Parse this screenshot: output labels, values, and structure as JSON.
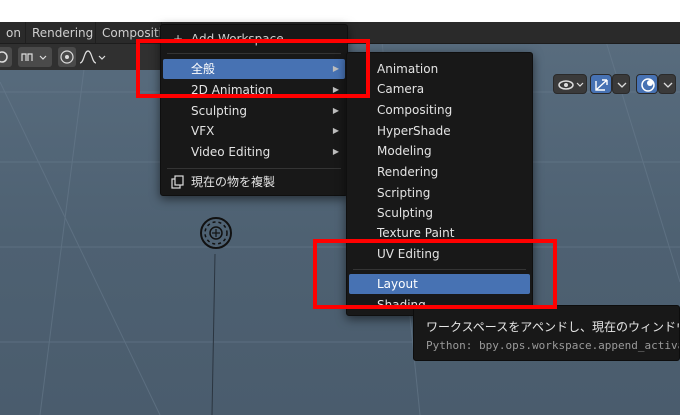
{
  "topbar": {
    "tabs": [
      {
        "label": "on"
      },
      {
        "label": "Rendering"
      },
      {
        "label": "Compositi"
      }
    ]
  },
  "header": {
    "select_mode_icon": "object-select-icon",
    "snap_icon": "snap-icon",
    "proportional_icon": "proportional-edit-icon",
    "falloff_icon": "falloff-curve-icon"
  },
  "viewport_tools": {
    "visibility_icon": "eye-icon",
    "gizmo_icon": "gizmo-icon",
    "overlay_icon": "overlay-icon"
  },
  "add_menu": {
    "header_label": "Add Workspace",
    "items": [
      {
        "label": "全般",
        "highlighted": true
      },
      {
        "label": "2D Animation"
      },
      {
        "label": "Sculpting"
      },
      {
        "label": "VFX"
      },
      {
        "label": "Video Editing"
      }
    ],
    "duplicate_label": "現在の物を複製",
    "duplicate_icon": "duplicate-icon"
  },
  "sub_menu": {
    "items": [
      {
        "label": "Animation"
      },
      {
        "label": "Camera"
      },
      {
        "label": "Compositing"
      },
      {
        "label": "HyperShade"
      },
      {
        "label": "Modeling"
      },
      {
        "label": "Rendering"
      },
      {
        "label": "Scripting"
      },
      {
        "label": "Sculpting"
      },
      {
        "label": "Texture Paint"
      },
      {
        "label": "UV Editing"
      },
      {
        "label": "Layout",
        "highlighted": true
      },
      {
        "label": "Shading"
      }
    ]
  },
  "tooltip": {
    "description": "ワークスペースをアペンドし、現在のウィンドウで",
    "python": "Python: bpy.ops.workspace.append_activate"
  },
  "colors": {
    "highlight": "#4772b3",
    "menu_bg": "#181818",
    "annotation_red": "#ff0000",
    "viewport_bg": "#55697b"
  }
}
